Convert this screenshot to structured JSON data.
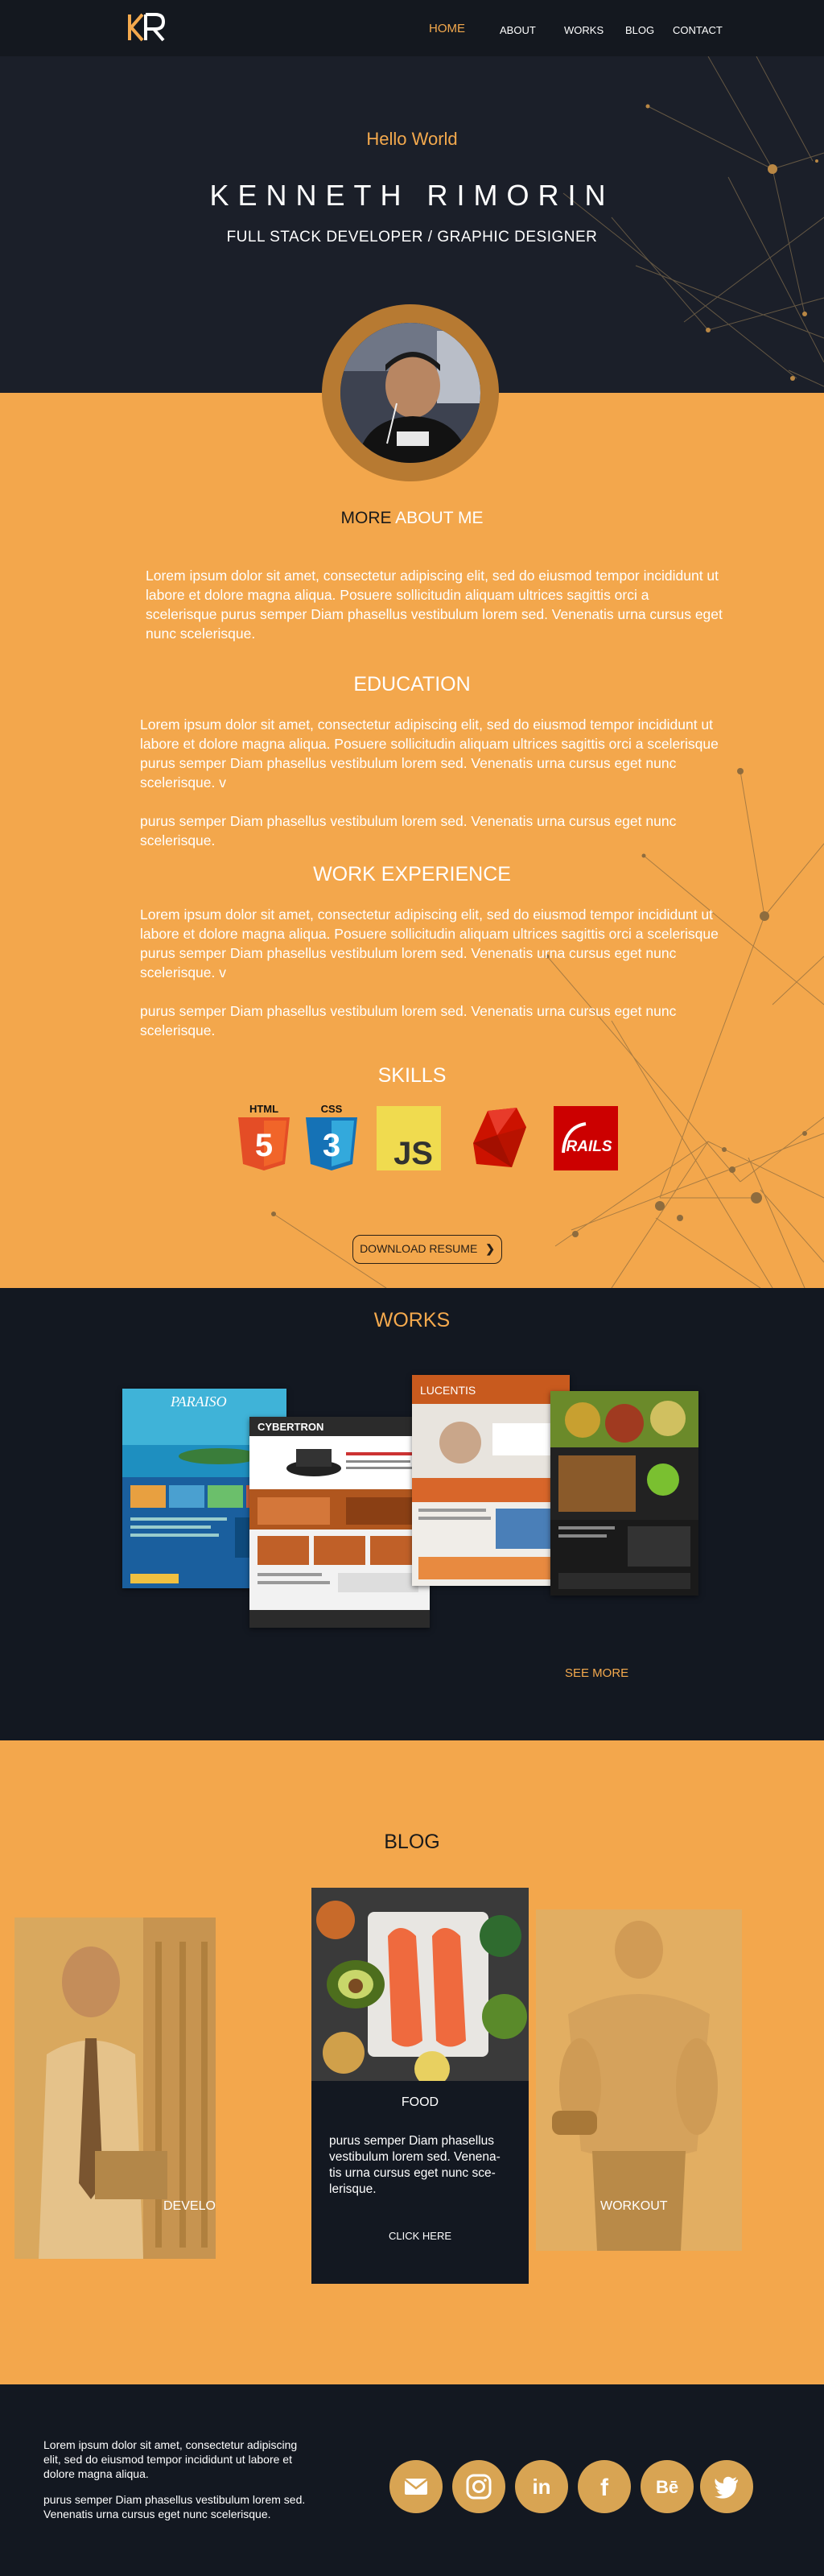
{
  "brand": {
    "logo_text": "KR",
    "accent": "#f4a94d",
    "dark": "#131821",
    "orange": "#f3a74c"
  },
  "nav": {
    "items": [
      {
        "label": "HOME",
        "active": true
      },
      {
        "label": "ABOUT",
        "active": false
      },
      {
        "label": "WORKS",
        "active": false
      },
      {
        "label": "BLOG",
        "active": false
      },
      {
        "label": "CONTACT",
        "active": false
      }
    ]
  },
  "hero": {
    "greeting": "Hello World",
    "name": "KENNETH RIMORIN",
    "role": "FULL STACK DEVELOPER /  GRAPHIC DESIGNER"
  },
  "about": {
    "title_strong": "MORE",
    "title_rest": " ABOUT ME",
    "intro": "Lorem ipsum dolor sit amet, consectetur adipiscing elit, sed do eiusmod tempor incididunt ut labore et dolore magna aliqua. Posuere sollicitudin aliquam ultrices sagittis orci a scelerisque purus semper Diam phasellus vestibulum lorem sed. Venenatis urna cursus eget nunc scelerisque.",
    "education": {
      "title": "EDUCATION",
      "p1": "Lorem ipsum dolor sit amet, consectetur adipiscing elit, sed do eiusmod tempor incididunt ut labore et dolore magna aliqua. Posuere sollicitudin aliquam ultrices sagittis orci a scelerisque purus semper Diam phasellus vestibulum lorem sed. Venenatis urna cursus eget nunc scelerisque. v",
      "p2": "purus semper Diam phasellus vestibulum lorem sed. Venenatis urna cursus eget nunc scelerisque."
    },
    "work": {
      "title": "WORK EXPERIENCE",
      "p1": "Lorem ipsum dolor sit amet, consectetur adipiscing elit, sed do eiusmod tempor incididunt ut labore et dolore magna aliqua. Posuere sollicitudin aliquam ultrices sagittis orci a scelerisque purus semper Diam phasellus vestibulum lorem sed. Venenatis urna cursus eget nunc scelerisque. v",
      "p2": "purus semper Diam phasellus vestibulum lorem sed. Venenatis urna cursus eget nunc scelerisque."
    },
    "skills": {
      "title": "SKILLS",
      "items": [
        {
          "label": "HTML",
          "icon": "html5-icon"
        },
        {
          "label": "CSS",
          "icon": "css3-icon"
        },
        {
          "label": "JS",
          "icon": "javascript-icon"
        },
        {
          "label": "",
          "icon": "ruby-icon"
        },
        {
          "label": "RAILS",
          "icon": "rails-icon"
        }
      ]
    },
    "download_label": "DOWNLOAD RESUME"
  },
  "works": {
    "title": "WORKS",
    "see_more": "SEE MORE",
    "shots": [
      {
        "name": "paraiso-screenshot",
        "title": "PARAISO"
      },
      {
        "name": "cybertron-screenshot",
        "title": "CYBERTRON"
      },
      {
        "name": "lucentis-screenshot",
        "title": "LUCENTIS"
      },
      {
        "name": "restaurant-screenshot",
        "title": ""
      }
    ]
  },
  "blog": {
    "title": "BLOG",
    "cards": [
      {
        "label": "DEVELOPER"
      },
      {
        "label": "FOOD",
        "text": "purus semper Diam phasellus vestibulum lorem sed. Venena-tis urna cursus eget nunc sce-lerisque.",
        "cta": "CLICK HERE"
      },
      {
        "label": "WORKOUT"
      }
    ]
  },
  "footer": {
    "p1": "Lorem ipsum dolor sit amet, consectetur adipiscing elit, sed do eiusmod tempor incididunt ut labore et dolore magna aliqua.",
    "p2": "purus semper Diam phasellus vestibulum lorem sed. Venenatis urna cursus eget nunc scelerisque.",
    "socials": [
      "mail-icon",
      "instagram-icon",
      "linkedin-icon",
      "facebook-icon",
      "behance-icon",
      "twitter-icon"
    ],
    "linkedin_text": "in",
    "facebook_text": "f",
    "behance_text": "Bē"
  }
}
